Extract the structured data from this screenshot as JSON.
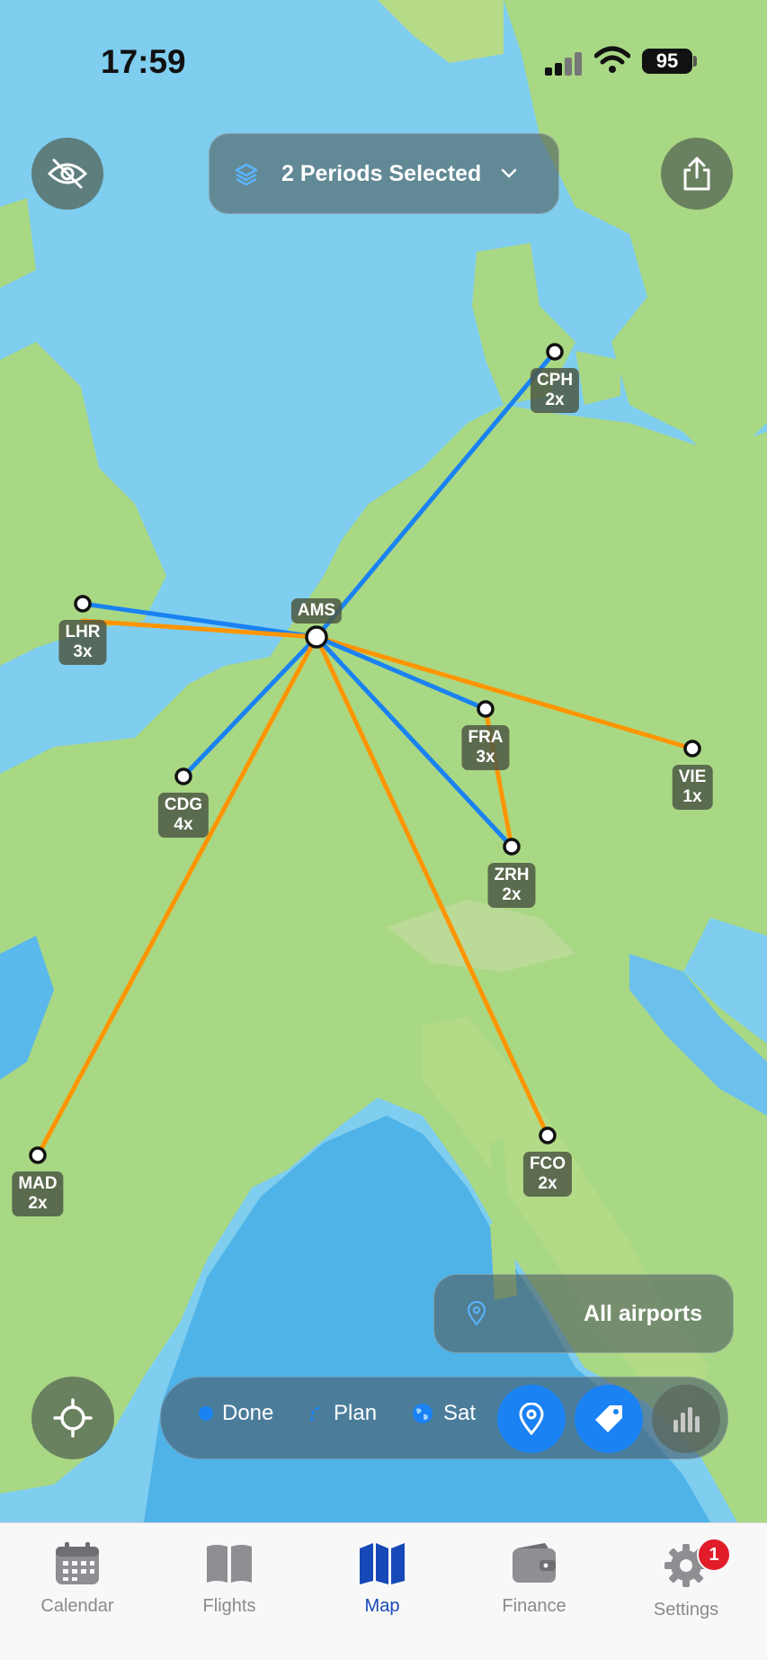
{
  "status_bar": {
    "time": "17:59",
    "battery": "95"
  },
  "header": {
    "period_selector_label": "2 Periods Selected"
  },
  "map": {
    "hub": "AMS",
    "colors": {
      "done": "#1a82f2",
      "plan": "#ff9500"
    },
    "airports": [
      {
        "code": "CPH",
        "count": "2x"
      },
      {
        "code": "LHR",
        "count": "3x"
      },
      {
        "code": "FRA",
        "count": "3x"
      },
      {
        "code": "VIE",
        "count": "1x"
      },
      {
        "code": "CDG",
        "count": "4x"
      },
      {
        "code": "ZRH",
        "count": "2x"
      },
      {
        "code": "MAD",
        "count": "2x"
      },
      {
        "code": "FCO",
        "count": "2x"
      }
    ]
  },
  "filter": {
    "airports_label": "All airports"
  },
  "legend": {
    "done_label": "Done",
    "plan_label": "Plan",
    "sat_label": "Sat"
  },
  "tabs": [
    {
      "label": "Calendar"
    },
    {
      "label": "Flights"
    },
    {
      "label": "Map"
    },
    {
      "label": "Finance"
    },
    {
      "label": "Settings",
      "badge": "1"
    }
  ],
  "active_tab": "Map"
}
